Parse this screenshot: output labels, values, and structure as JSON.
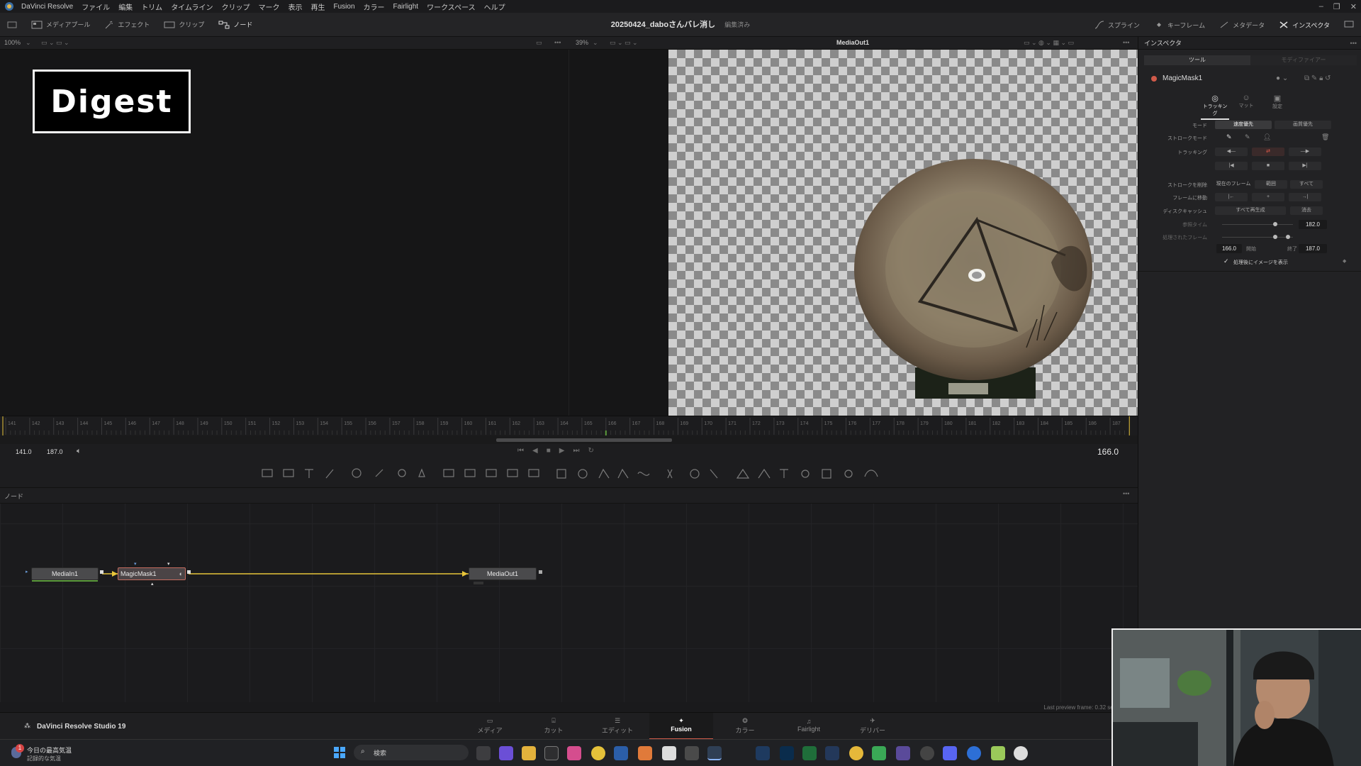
{
  "menubar": {
    "items": [
      "DaVinci Resolve",
      "ファイル",
      "編集",
      "トリム",
      "タイムライン",
      "クリップ",
      "マーク",
      "表示",
      "再生",
      "Fusion",
      "カラー",
      "Fairlight",
      "ワークスペース",
      "ヘルプ"
    ]
  },
  "toolbar": {
    "media_pool": "メディアプール",
    "effects": "エフェクト",
    "clips": "クリップ",
    "nodes": "ノード",
    "project_name": "20250424_daboさんバレ消し",
    "project_status": "編集済み",
    "spline": "スプライン",
    "keyframes": "キーフレーム",
    "metadata": "メタデータ",
    "inspector": "インスペクタ"
  },
  "viewer": {
    "left_zoom": "100%",
    "right_zoom": "39%",
    "right_title": "MediaOut1",
    "overlay_text": "Digest"
  },
  "ruler": {
    "ticks": [
      "141",
      "142",
      "143",
      "144",
      "145",
      "146",
      "147",
      "148",
      "149",
      "150",
      "151",
      "152",
      "153",
      "154",
      "155",
      "156",
      "157",
      "158",
      "159",
      "160",
      "161",
      "162",
      "163",
      "164",
      "165",
      "166",
      "167",
      "168",
      "169",
      "170",
      "171",
      "172",
      "173",
      "174",
      "175",
      "176",
      "177",
      "178",
      "179",
      "180",
      "181",
      "182",
      "183",
      "184",
      "185",
      "186",
      "187"
    ]
  },
  "transport": {
    "start": "141.0",
    "end": "187.0",
    "current": "166.0"
  },
  "nodes_panel": {
    "title": "ノード",
    "node_in": "MediaIn1",
    "node_mask": "MagicMask1",
    "node_out": "MediaOut1"
  },
  "status": {
    "preview": "Last preview frame: 0.32 secs, Aver"
  },
  "pages": {
    "brand": "DaVinci Resolve Studio 19",
    "tabs": [
      "メディア",
      "カット",
      "エディット",
      "Fusion",
      "カラー",
      "Fairlight",
      "デリバー"
    ],
    "active": "Fusion"
  },
  "inspector": {
    "title": "インスペクタ",
    "tab_tools": "ツール",
    "tab_modifiers": "モディファイアー",
    "tool_name": "MagicMask1",
    "sub_tabs": [
      "トラッキング",
      "マット",
      "設定"
    ],
    "mode_label": "モード",
    "mode_fast": "速度優先",
    "mode_quality": "画質優先",
    "stroke_mode_label": "ストロークモード",
    "tracking_label": "トラッキング",
    "delete_strokes_label": "ストロークを削除",
    "del_current": "現在のフレーム",
    "del_range": "範囲",
    "del_all": "すべて",
    "goto_frame_label": "フレームに移動",
    "disk_cache_label": "ディスクキャッシュ",
    "regen_all": "すべて再生成",
    "clear": "消去",
    "ref_time_label": "参照タイム",
    "ref_time_value": "182.0",
    "processed_label": "処理されたフレーム",
    "range_start": "166.0",
    "start_label": "開始",
    "end_label": "終了",
    "range_end": "187.0",
    "checkbox_label": "処理後にイメージを表示"
  },
  "taskbar": {
    "weather_line1": "今日の最高気温",
    "weather_line2": "記録的な気温",
    "search_placeholder": "検索",
    "badge": "1"
  },
  "colors": {
    "accent_red": "#d05a4a",
    "node_link": "#e8c53a",
    "selected_node_border": "#c46b5e"
  }
}
